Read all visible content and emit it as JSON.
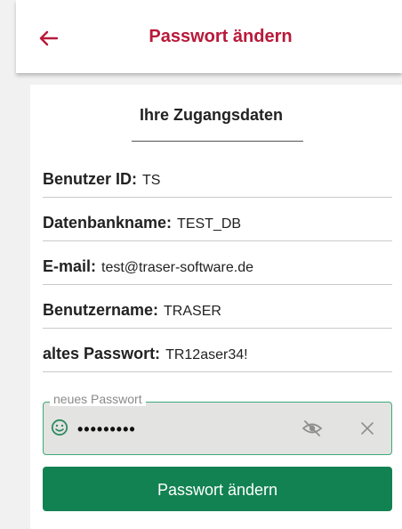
{
  "colors": {
    "accent": "#b8193a",
    "primary_button": "#128252",
    "field_border": "#3fa97a"
  },
  "header": {
    "back_icon": "arrow-left-icon",
    "title": "Passwort ändern"
  },
  "card": {
    "section_title": "Ihre Zugangsdaten",
    "rows": [
      {
        "label": "Benutzer ID:",
        "value": "TS"
      },
      {
        "label": "Datenbankname:",
        "value": "TEST_DB"
      },
      {
        "label": "E-mail:",
        "value": "test@traser-software.de"
      },
      {
        "label": "Benutzername:",
        "value": "TRASER"
      },
      {
        "label": "altes Passwort:",
        "value": "TR12aser34!"
      }
    ],
    "new_password": {
      "label": "neues Passwort",
      "value": "•••••••••",
      "icons": [
        "smiley-icon",
        "eye-off-icon",
        "close-icon"
      ]
    },
    "submit_label": "Passwort ändern"
  }
}
